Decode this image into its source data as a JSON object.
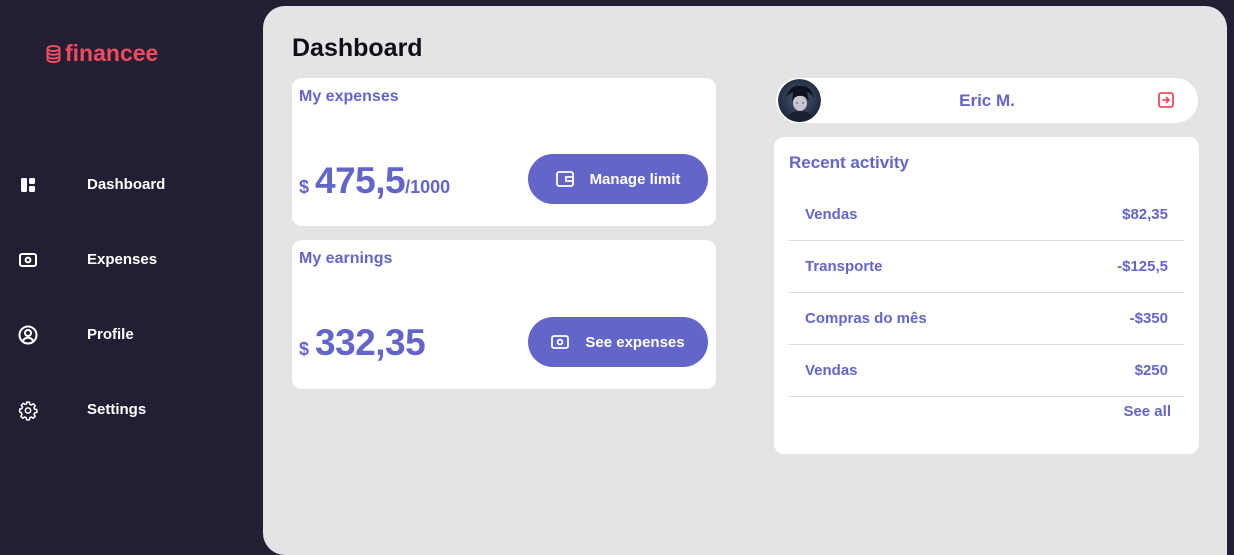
{
  "brand": {
    "name": "financee",
    "icon": "database-icon",
    "color": "#f24b5f"
  },
  "sidebar": {
    "items": [
      {
        "label": "Dashboard",
        "icon": "dashboard-grid-icon"
      },
      {
        "label": "Expenses",
        "icon": "money-bill-icon"
      },
      {
        "label": "Profile",
        "icon": "user-circle-icon"
      },
      {
        "label": "Settings",
        "icon": "gear-icon"
      }
    ]
  },
  "main": {
    "title": "Dashboard",
    "expenses": {
      "title": "My expenses",
      "currency": "$",
      "amount": "475,5",
      "limit": "/1000",
      "button_label": "Manage limit",
      "button_icon": "wallet-icon"
    },
    "earnings": {
      "title": "My earnings",
      "currency": "$",
      "amount": "332,35",
      "button_label": "See expenses",
      "button_icon": "money-bill-icon"
    }
  },
  "user": {
    "name": "Eric M.",
    "avatar": "avatar",
    "logout_icon": "logout-icon"
  },
  "activity": {
    "title": "Recent activity",
    "rows": [
      {
        "label": "Vendas",
        "value": "$82,35"
      },
      {
        "label": "Transporte",
        "value": "-$125,5"
      },
      {
        "label": "Compras do mês",
        "value": "-$350"
      },
      {
        "label": "Vendas",
        "value": "$250"
      }
    ],
    "see_all": "See all"
  },
  "colors": {
    "sidebar_bg": "#221f35",
    "main_bg": "#e3e4e6",
    "accent": "#6366c8",
    "brand": "#f24b5f"
  }
}
